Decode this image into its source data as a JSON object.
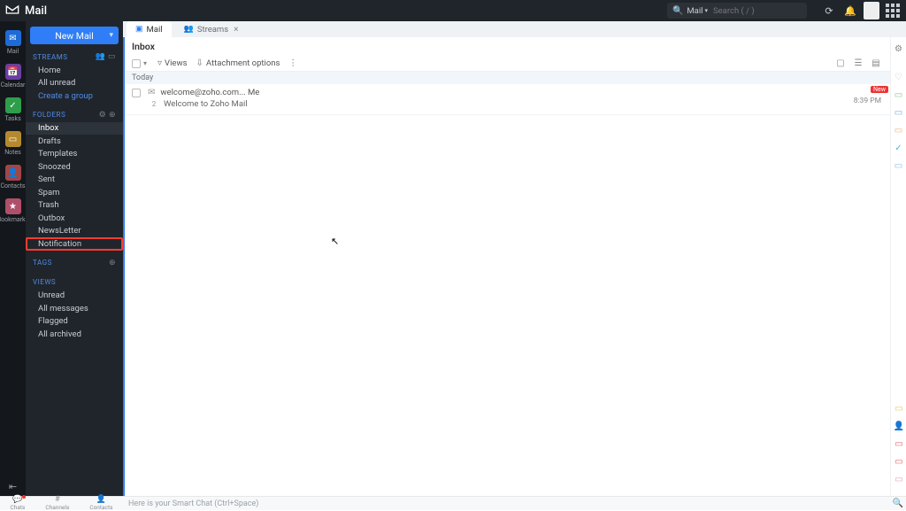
{
  "brand": {
    "name": "Mail"
  },
  "search": {
    "scope": "Mail",
    "placeholder": "Search ( / )"
  },
  "leftrail": [
    {
      "label": "Mail",
      "color": "#1e6bd6",
      "glyph": "✉"
    },
    {
      "label": "Calendar",
      "color": "#6b3fa0",
      "glyph": "📅"
    },
    {
      "label": "Tasks",
      "color": "#2e9e4b",
      "glyph": "✓"
    },
    {
      "label": "Notes",
      "color": "#b58a2e",
      "glyph": "▭"
    },
    {
      "label": "Contacts",
      "color": "#a04646",
      "glyph": "👤"
    },
    {
      "label": "Bookmarks",
      "color": "#b04f6a",
      "glyph": "★"
    }
  ],
  "newmail": {
    "label": "New Mail"
  },
  "streams": {
    "title": "STREAMS",
    "items": [
      "Home",
      "All unread"
    ],
    "create": "Create a group"
  },
  "folders": {
    "title": "FOLDERS",
    "items": [
      "Inbox",
      "Drafts",
      "Templates",
      "Snoozed",
      "Sent",
      "Spam",
      "Trash",
      "Outbox",
      "NewsLetter",
      "Notification"
    ],
    "active": "Inbox",
    "highlighted": "Notification"
  },
  "tags": {
    "title": "TAGS"
  },
  "views": {
    "title": "VIEWS",
    "items": [
      "Unread",
      "All messages",
      "Flagged",
      "All archived"
    ]
  },
  "tabs": [
    {
      "label": "Mail",
      "icon": "mail",
      "closable": false
    },
    {
      "label": "Streams",
      "icon": "streams",
      "closable": true
    }
  ],
  "listheader": {
    "title": "Inbox",
    "views_btn": "Views",
    "attachment_btn": "Attachment options",
    "today": "Today"
  },
  "messages": [
    {
      "from": "welcome@zoho.com... Me",
      "thread_count": "2",
      "subject": "Welcome to Zoho Mail",
      "time": "8:39 PM",
      "new": true
    }
  ],
  "chatbar": {
    "items": [
      "Chats",
      "Channels",
      "Contacts"
    ],
    "placeholder": "Here is your Smart Chat (Ctrl+Space)"
  },
  "colors": {
    "accent": "#2f7ef7",
    "highlight": "#ff3b30"
  }
}
